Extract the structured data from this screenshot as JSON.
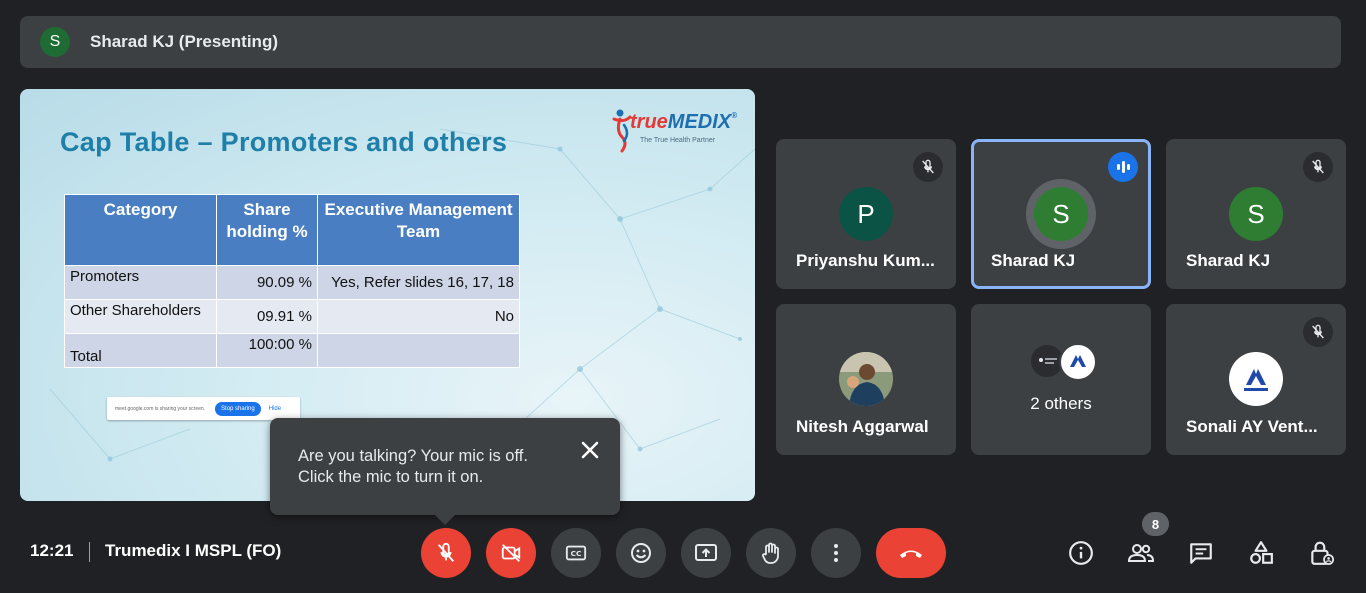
{
  "presenter_bar": {
    "avatar_letter": "S",
    "name": "Sharad KJ (Presenting)"
  },
  "slide": {
    "title": "Cap Table – Promoters and others",
    "logo": {
      "brand_part1": "true",
      "brand_part2": "MEDIX",
      "reg": "®",
      "tagline": "The True Health Partner"
    },
    "table": {
      "headers": [
        "Category",
        "Share holding %",
        "Executive Management Team"
      ],
      "rows": [
        [
          "Promoters",
          "90.09 %",
          "Yes, Refer slides 16, 17, 18"
        ],
        [
          "Other Shareholders",
          "09.91 %",
          "No"
        ],
        [
          "Total",
          "100:00 %",
          ""
        ]
      ]
    },
    "share_notice": {
      "text": "meet.google.com is sharing your screen.",
      "stop_label": "Stop sharing",
      "hide_label": "Hide"
    }
  },
  "participants": [
    {
      "name": "Priyanshu Kum...",
      "avatar_letter": "P",
      "avatar_color": "#0b5345",
      "muted": true
    },
    {
      "name": "Sharad KJ",
      "avatar_letter": "S",
      "avatar_color": "#2e7d32",
      "speaking": true
    },
    {
      "name": "Sharad KJ",
      "avatar_letter": "S",
      "avatar_color": "#2e7d32",
      "muted": true
    },
    {
      "name": "Nitesh Aggarwal",
      "avatar": "photo"
    },
    {
      "name": "2 others"
    },
    {
      "name": "Sonali AY Vent...",
      "avatar_logo": "AY VENTURES",
      "muted": true
    }
  ],
  "tooltip": {
    "text": "Are you talking? Your mic is off. Click the mic to turn it on."
  },
  "bottom_bar": {
    "time": "12:21",
    "meeting_title": "Trumedix I MSPL (FO)",
    "people_count": "8"
  },
  "colors": {
    "background": "#202124",
    "tile": "#3c4043",
    "danger": "#ea4335",
    "accent": "#8ab4f8"
  }
}
